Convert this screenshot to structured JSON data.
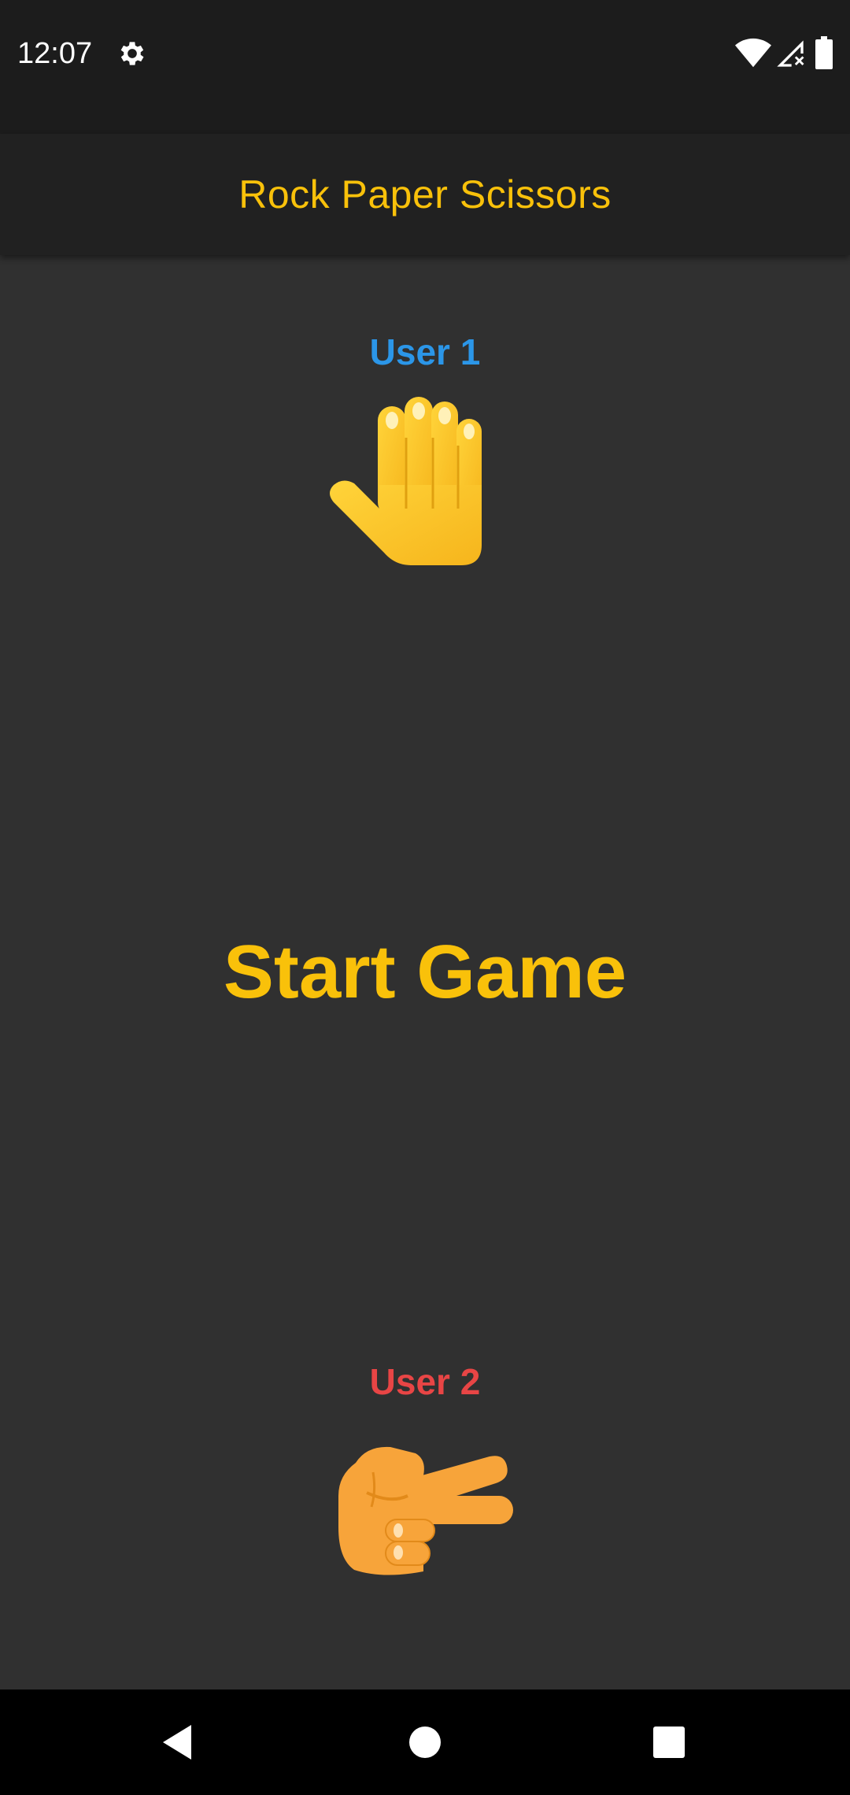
{
  "status_bar": {
    "time": "12:07",
    "icons": [
      "gear-icon",
      "wifi-icon",
      "signal-icon",
      "battery-icon"
    ]
  },
  "app_bar": {
    "title": "Rock Paper Scissors"
  },
  "players": {
    "user1": {
      "label": "User 1",
      "color": "#2b96e8",
      "hand": "raised-hand-icon"
    },
    "user2": {
      "label": "User 2",
      "color": "#e84545",
      "hand": "scissors-hand-icon"
    }
  },
  "main": {
    "start_label": "Start Game"
  },
  "nav_bar": {
    "icons": [
      "back-icon",
      "home-icon",
      "recents-icon"
    ]
  },
  "colors": {
    "accent": "#f9c10a",
    "background": "#303030",
    "app_bar": "#212121"
  }
}
